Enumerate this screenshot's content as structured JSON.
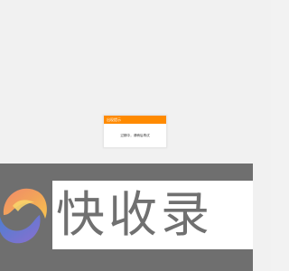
{
  "dialog": {
    "title": "出现提示",
    "message": "过期中，请稍后再试"
  },
  "watermark": {
    "text": "快收录",
    "logo_icon": "swirl-s-logo-icon"
  },
  "colors": {
    "background": "#f1f1f1",
    "dialog_header": "#ff8a00",
    "watermark_band": "#5a5a5a",
    "watermark_text": "#707070"
  }
}
